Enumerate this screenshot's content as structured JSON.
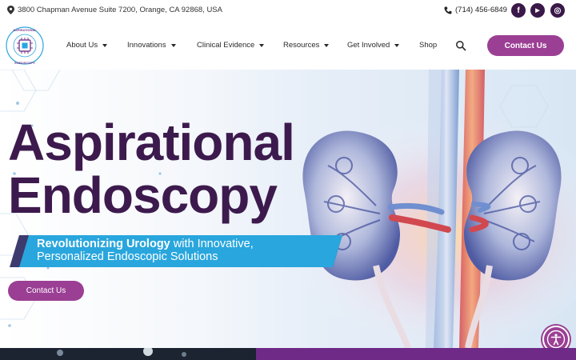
{
  "topbar": {
    "address": "3800 Chapman Avenue Suite 7200, Orange, CA 92868, USA",
    "phone": "(714) 456-6849",
    "social": [
      {
        "icon": "facebook-icon",
        "glyph": "f"
      },
      {
        "icon": "youtube-icon",
        "glyph": "▶"
      },
      {
        "icon": "instagram-icon",
        "glyph": "◎"
      }
    ]
  },
  "nav": {
    "items": [
      {
        "label": "About Us",
        "dropdown": true
      },
      {
        "label": "Innovations",
        "dropdown": true
      },
      {
        "label": "Clinical Evidence",
        "dropdown": true
      },
      {
        "label": "Resources",
        "dropdown": true
      },
      {
        "label": "Get Involved",
        "dropdown": true
      },
      {
        "label": "Shop",
        "dropdown": false
      }
    ],
    "contact_label": "Contact Us"
  },
  "logo": {
    "text_top": "ASPIRATIONAL",
    "text_bottom": "ENDOSCOPY"
  },
  "hero": {
    "title_line1": "Aspirational",
    "title_line2": "Endoscopy",
    "tagline_bold": "Revolutionizing Urology",
    "tagline_rest": " with Innovative,",
    "tagline_line2": "Personalized Endoscopic Solutions",
    "cta_label": "Contact Us"
  },
  "colors": {
    "brand_purple": "#9b3f94",
    "title_purple": "#3d1a4d",
    "ribbon_blue": "#29a6dd",
    "ribbon_dark": "#3d3a6e"
  }
}
